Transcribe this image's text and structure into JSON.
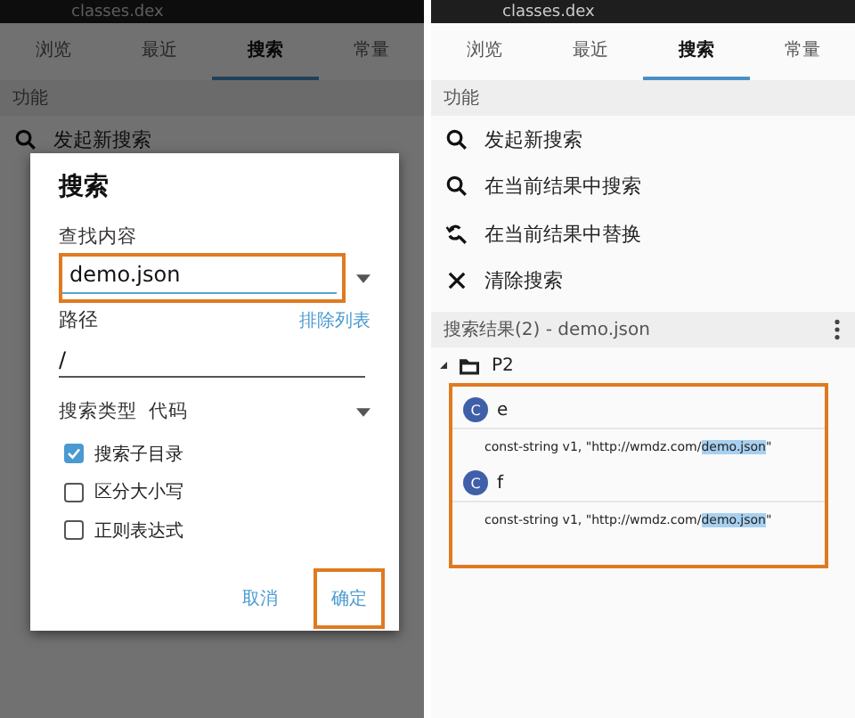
{
  "left_screen": {
    "header_title": "classes.dex",
    "tabs": [
      {
        "label": "浏览",
        "selected": false
      },
      {
        "label": "最近",
        "selected": false
      },
      {
        "label": "搜索",
        "selected": true
      },
      {
        "label": "常量",
        "selected": false
      }
    ],
    "section_title": "功能",
    "first_item": "发起新搜索",
    "dialog": {
      "title": "搜索",
      "query_label": "查找内容",
      "query_value": "demo.json",
      "query_highlighted": true,
      "path_label": "路径",
      "exclude_link": "排除列表",
      "path_value": "/",
      "type_label": "搜索类型",
      "type_value": "代码",
      "options": [
        {
          "label": "搜索子目录",
          "checked": true
        },
        {
          "label": "区分大小写",
          "checked": false
        },
        {
          "label": "正则表达式",
          "checked": false
        }
      ],
      "buttons": [
        {
          "label": "取消",
          "highlighted": false
        },
        {
          "label": "确定",
          "highlighted": true
        }
      ]
    }
  },
  "right_screen": {
    "header_title": "classes.dex",
    "tabs": [
      {
        "label": "浏览",
        "selected": false
      },
      {
        "label": "最近",
        "selected": false
      },
      {
        "label": "搜索",
        "selected": true
      },
      {
        "label": "常量",
        "selected": false
      }
    ],
    "section_title": "功能",
    "actions": [
      {
        "kind": "search",
        "label": "发起新搜索"
      },
      {
        "kind": "search",
        "label": "在当前结果中搜索"
      },
      {
        "kind": "replace",
        "label": "在当前结果中替换"
      },
      {
        "kind": "clear",
        "label": "清除搜索"
      }
    ],
    "results_title": "搜索结果(2) - demo.json",
    "tree": {
      "label": "P2",
      "expanded": true,
      "highlighted": true,
      "children": [
        {
          "class_badge": "C",
          "name": "e",
          "code_before": "const-string v1, \"http://wmdz.com/",
          "code_match": "demo.json",
          "code_after": "\""
        },
        {
          "class_badge": "C",
          "name": "f",
          "code_before": "const-string v1, \"http://wmdz.com/",
          "code_match": "demo.json",
          "code_after": "\""
        }
      ]
    }
  }
}
